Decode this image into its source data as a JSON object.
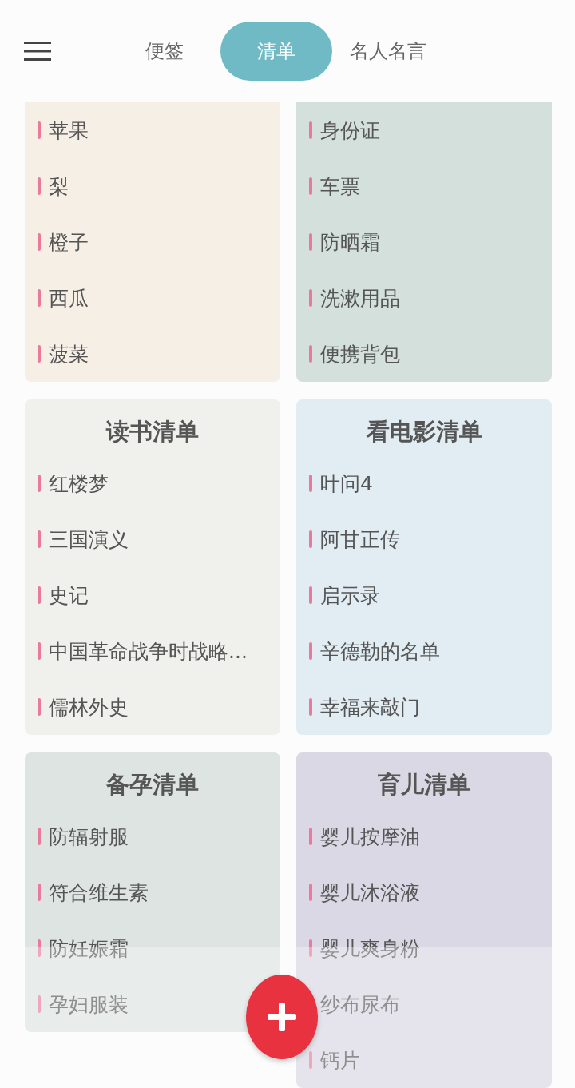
{
  "tabs": [
    {
      "label": "便签",
      "selected": false
    },
    {
      "label": "清单",
      "selected": true
    },
    {
      "label": "名人名言",
      "selected": false
    }
  ],
  "lists": [
    {
      "color": "#f6efe6",
      "items": [
        "苹果",
        "梨",
        "橙子",
        "西瓜",
        "菠菜"
      ]
    },
    {
      "color": "#d3e0dc",
      "items": [
        "身份证",
        "车票",
        "防晒霜",
        "洗漱用品",
        "便携背包"
      ]
    },
    {
      "title": "读书清单",
      "color": "#f0f0ec",
      "items": [
        "红楼梦",
        "三国演义",
        "史记",
        "中国革命战争时战略...",
        "儒林外史"
      ]
    },
    {
      "title": "看电影清单",
      "color": "#e1ecf3",
      "items": [
        "叶问4",
        "阿甘正传",
        "启示录",
        "辛德勒的名单",
        "幸福来敲门"
      ]
    },
    {
      "title": "备孕清单",
      "color": "#dde4e2",
      "items": [
        "防辐射服",
        "符合维生素",
        "防妊娠霜",
        "孕妇服装"
      ]
    },
    {
      "title": "育儿清单",
      "color": "#d9d8e4",
      "items": [
        "婴儿按摩油",
        "婴儿沐浴液",
        "婴儿爽身粉",
        "纱布尿布",
        "钙片"
      ]
    }
  ]
}
